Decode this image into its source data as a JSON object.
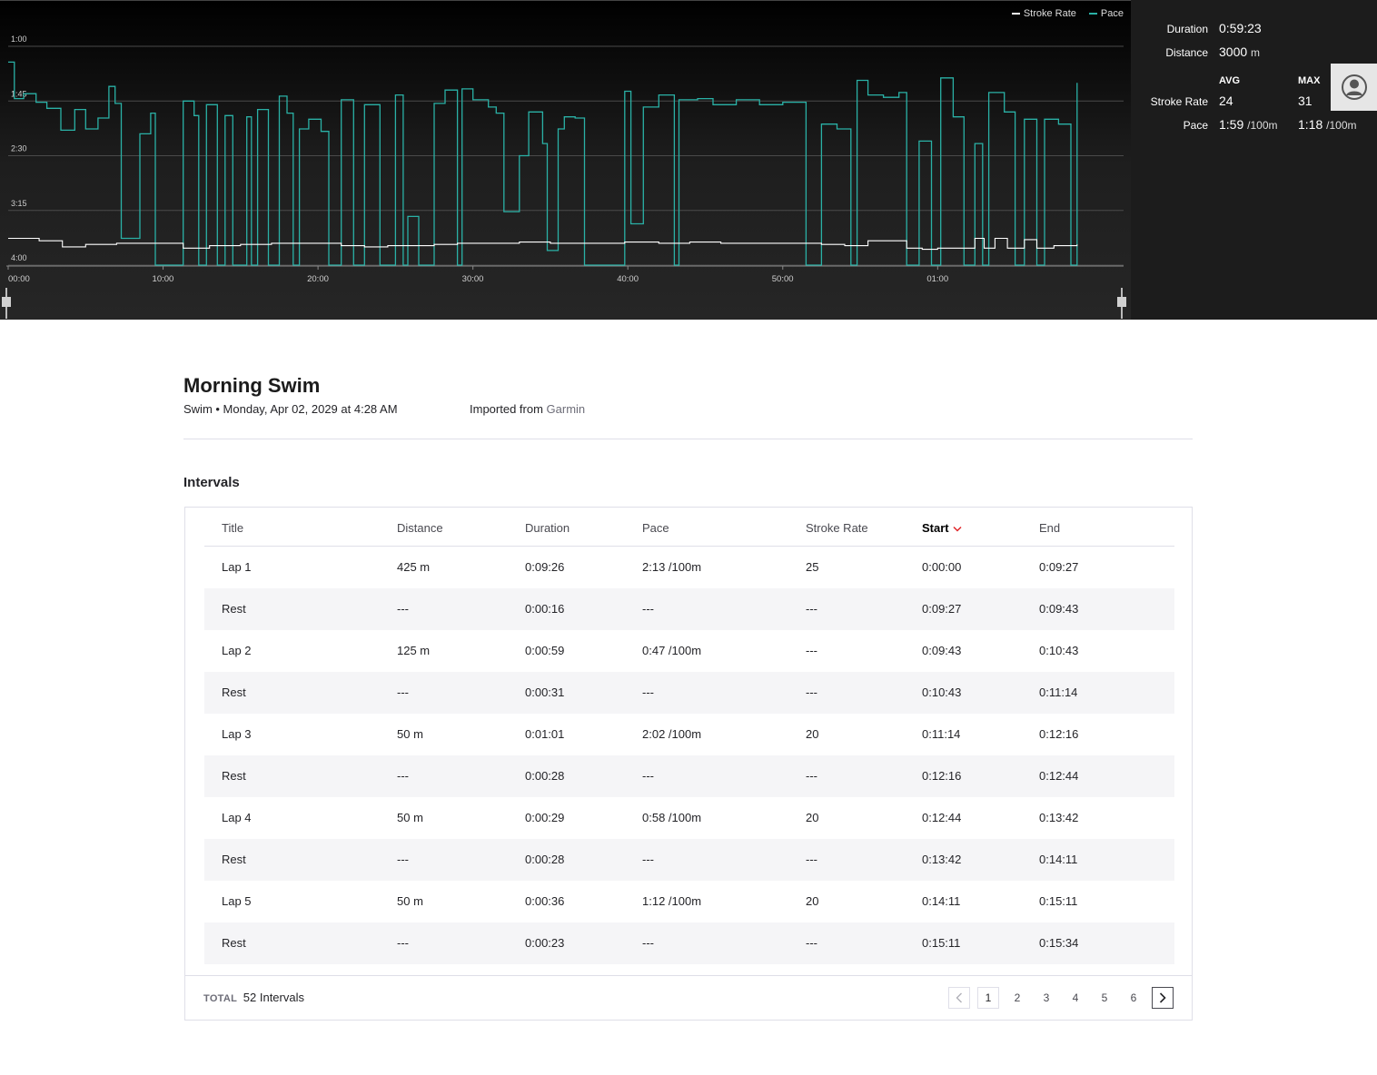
{
  "analysis": {
    "legend": [
      {
        "label": "Stroke Rate",
        "color": "#ffffff"
      },
      {
        "label": "Pace",
        "color": "#2ab1a6"
      }
    ],
    "stats": {
      "duration_label": "Duration",
      "duration_value": "0:59:23",
      "distance_label": "Distance",
      "distance_value": "3000",
      "distance_unit": "m",
      "avg_label": "AVG",
      "max_label": "MAX",
      "stroke_rate_label": "Stroke Rate",
      "stroke_rate_avg": "24",
      "stroke_rate_max": "31",
      "pace_label": "Pace",
      "pace_avg": "1:59",
      "pace_max": "1:18",
      "pace_unit": "/100m"
    }
  },
  "chart_data": {
    "type": "line",
    "title": "",
    "xlabel": "",
    "ylabel": "",
    "x_ticks": [
      "00:00",
      "10:00",
      "20:00",
      "30:00",
      "40:00",
      "50:00",
      "01:00"
    ],
    "y_ticks": [
      "1:00",
      "1:45",
      "2:30",
      "3:15",
      "4:00"
    ],
    "x_range_minutes": [
      0,
      72
    ],
    "y_range_pace_seconds_per_100m": [
      60,
      240
    ],
    "series": [
      {
        "name": "Pace",
        "color": "#2ab1a6",
        "points_minutes_seconds": [
          [
            0,
            73
          ],
          [
            0.4,
            103
          ],
          [
            1.0,
            99
          ],
          [
            1.8,
            106
          ],
          [
            2.5,
            111
          ],
          [
            3.4,
            129
          ],
          [
            4.3,
            112
          ],
          [
            5.0,
            128
          ],
          [
            5.8,
            119
          ],
          [
            6.5,
            93
          ],
          [
            6.9,
            107
          ],
          [
            7.3,
            218
          ],
          [
            8.3,
            218
          ],
          [
            8.5,
            132
          ],
          [
            9.2,
            115
          ],
          [
            9.5,
            240
          ],
          [
            11.3,
            105
          ],
          [
            12.0,
            117
          ],
          [
            12.3,
            240
          ],
          [
            12.8,
            108
          ],
          [
            13.5,
            240
          ],
          [
            14.0,
            117
          ],
          [
            14.5,
            240
          ],
          [
            15.4,
            118
          ],
          [
            15.7,
            240
          ],
          [
            16.1,
            112
          ],
          [
            16.8,
            240
          ],
          [
            17.5,
            101
          ],
          [
            18.0,
            115
          ],
          [
            18.4,
            240
          ],
          [
            18.8,
            128
          ],
          [
            19.4,
            120
          ],
          [
            20.2,
            130
          ],
          [
            20.7,
            240
          ],
          [
            21.5,
            104
          ],
          [
            22.3,
            240
          ],
          [
            23.0,
            108
          ],
          [
            24.0,
            240
          ],
          [
            25.0,
            100
          ],
          [
            25.5,
            240
          ],
          [
            25.8,
            200
          ],
          [
            26.5,
            240
          ],
          [
            27.5,
            107
          ],
          [
            28.2,
            96
          ],
          [
            29.0,
            240
          ],
          [
            29.3,
            95
          ],
          [
            30.0,
            104
          ],
          [
            31.0,
            110
          ],
          [
            31.5,
            115
          ],
          [
            32.0,
            196
          ],
          [
            33.0,
            150
          ],
          [
            33.6,
            114
          ],
          [
            34.5,
            140
          ],
          [
            34.8,
            228
          ],
          [
            35.5,
            128
          ],
          [
            35.9,
            118
          ],
          [
            36.6,
            119
          ],
          [
            37.2,
            240
          ],
          [
            39.8,
            97
          ],
          [
            40.2,
            206
          ],
          [
            41.0,
            110
          ],
          [
            42.0,
            100
          ],
          [
            43.0,
            240
          ],
          [
            43.3,
            104
          ],
          [
            44.5,
            103
          ],
          [
            45.5,
            108
          ],
          [
            47.0,
            104
          ],
          [
            48.5,
            108
          ],
          [
            50.0,
            106
          ],
          [
            51.5,
            240
          ],
          [
            52.5,
            124
          ],
          [
            53.5,
            128
          ],
          [
            54.4,
            240
          ],
          [
            54.8,
            88
          ],
          [
            55.5,
            100
          ],
          [
            56.5,
            102
          ],
          [
            57.5,
            98
          ],
          [
            58.0,
            240
          ],
          [
            58.8,
            138
          ],
          [
            59.6,
            240
          ],
          [
            60.2,
            86
          ],
          [
            61.0,
            118
          ],
          [
            61.7,
            240
          ],
          [
            62.4,
            140
          ],
          [
            62.9,
            240
          ],
          [
            63.3,
            98
          ],
          [
            64.3,
            114
          ],
          [
            65.0,
            240
          ],
          [
            65.6,
            120
          ],
          [
            66.4,
            240
          ],
          [
            66.9,
            120
          ],
          [
            67.8,
            124
          ],
          [
            68.6,
            240
          ],
          [
            69.0,
            90
          ]
        ]
      },
      {
        "name": "Stroke Rate",
        "color": "#ffffff",
        "points_minutes_seconds": [
          [
            0,
            218
          ],
          [
            2.0,
            220
          ],
          [
            3.5,
            225
          ],
          [
            5.0,
            223
          ],
          [
            7.0,
            222
          ],
          [
            9.5,
            222
          ],
          [
            11.3,
            226
          ],
          [
            13.0,
            224
          ],
          [
            15.0,
            223
          ],
          [
            17.0,
            222
          ],
          [
            19.0,
            222
          ],
          [
            20.7,
            222
          ],
          [
            21.5,
            224
          ],
          [
            23.0,
            225
          ],
          [
            24.5,
            224
          ],
          [
            26.5,
            224
          ],
          [
            27.5,
            223
          ],
          [
            29.0,
            222
          ],
          [
            31.0,
            222
          ],
          [
            33.0,
            221
          ],
          [
            35.0,
            222
          ],
          [
            37.2,
            222
          ],
          [
            39.8,
            221
          ],
          [
            42.0,
            222
          ],
          [
            44.0,
            221
          ],
          [
            46.0,
            222
          ],
          [
            48.0,
            222
          ],
          [
            51.5,
            222
          ],
          [
            52.5,
            223
          ],
          [
            54.0,
            224
          ],
          [
            55.5,
            220
          ],
          [
            57.0,
            220
          ],
          [
            58.0,
            226
          ],
          [
            59.0,
            227
          ],
          [
            60.0,
            226
          ],
          [
            61.7,
            226
          ],
          [
            62.4,
            218
          ],
          [
            63.0,
            226
          ],
          [
            63.7,
            218
          ],
          [
            64.5,
            226
          ],
          [
            65.6,
            219
          ],
          [
            66.4,
            226
          ],
          [
            67.5,
            224
          ],
          [
            69.0,
            223
          ]
        ]
      }
    ]
  },
  "activity": {
    "title": "Morning Swim",
    "subtitle": "Swim • Monday, Apr 02, 2029 at 4:28 AM",
    "imported_label": "Imported from",
    "imported_source": "Garmin"
  },
  "intervals": {
    "section_title": "Intervals",
    "headers": [
      "Title",
      "Distance",
      "Duration",
      "Pace",
      "Stroke Rate",
      "Start",
      "End"
    ],
    "sorted_column": 5,
    "rows": [
      [
        "Lap 1",
        "425 m",
        "0:09:26",
        "2:13 /100m",
        "25",
        "0:00:00",
        "0:09:27"
      ],
      [
        "Rest",
        "---",
        "0:00:16",
        "---",
        "---",
        "0:09:27",
        "0:09:43"
      ],
      [
        "Lap 2",
        "125 m",
        "0:00:59",
        "0:47 /100m",
        "---",
        "0:09:43",
        "0:10:43"
      ],
      [
        "Rest",
        "---",
        "0:00:31",
        "---",
        "---",
        "0:10:43",
        "0:11:14"
      ],
      [
        "Lap 3",
        "50 m",
        "0:01:01",
        "2:02 /100m",
        "20",
        "0:11:14",
        "0:12:16"
      ],
      [
        "Rest",
        "---",
        "0:00:28",
        "---",
        "---",
        "0:12:16",
        "0:12:44"
      ],
      [
        "Lap 4",
        "50 m",
        "0:00:29",
        "0:58 /100m",
        "20",
        "0:12:44",
        "0:13:42"
      ],
      [
        "Rest",
        "---",
        "0:00:28",
        "---",
        "---",
        "0:13:42",
        "0:14:11"
      ],
      [
        "Lap 5",
        "50 m",
        "0:00:36",
        "1:12 /100m",
        "20",
        "0:14:11",
        "0:15:11"
      ],
      [
        "Rest",
        "---",
        "0:00:23",
        "---",
        "---",
        "0:15:11",
        "0:15:34"
      ]
    ],
    "total_label": "TOTAL",
    "total_value": "52 Intervals",
    "pages": [
      "1",
      "2",
      "3",
      "4",
      "5",
      "6"
    ],
    "current_page": "1"
  }
}
